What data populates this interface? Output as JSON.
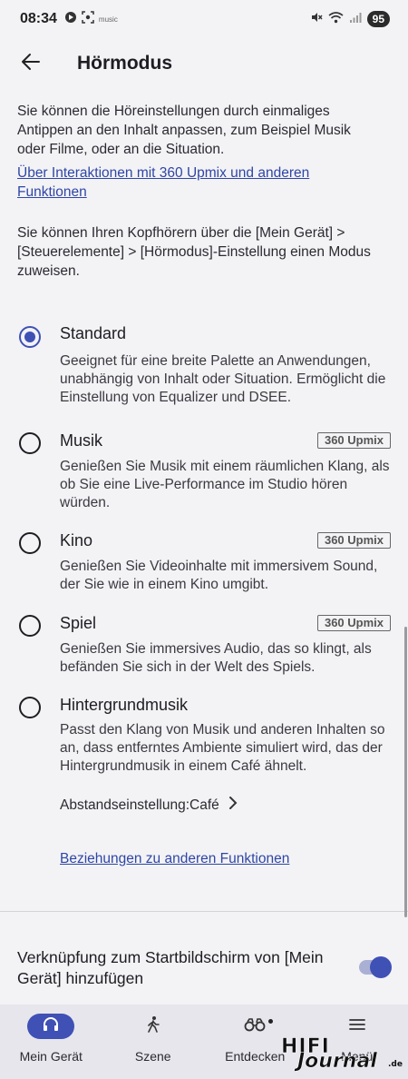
{
  "status_bar": {
    "time": "08:34",
    "battery": "95",
    "left_icons": [
      "podcast-icon",
      "screenshot-icon",
      "music-icon"
    ],
    "music_label": "music",
    "right_icons": [
      "mute-icon",
      "wifi-icon",
      "signal-icon"
    ]
  },
  "header": {
    "title": "Hörmodus",
    "back_icon": "arrow-left-icon"
  },
  "intro": {
    "text": "Sie können die Höreinstellungen durch einmaliges Antippen an den Inhalt anpassen, zum Beispiel Musik oder Filme, oder an die Situation.",
    "link": "Über Interaktionen mit 360 Upmix und anderen Funktionen",
    "assign_text": "Sie können Ihren Kopfhörern über die [Mein Gerät] > [Steuerelemente] > [Hörmodus]-Einstellung einen Modus zuweisen."
  },
  "options": [
    {
      "title": "Standard",
      "selected": true,
      "badge": "",
      "desc": "Geeignet für eine breite Palette an Anwendungen, unabhängig von Inhalt oder Situation. Ermöglicht die Einstellung von Equalizer und DSEE."
    },
    {
      "title": "Musik",
      "selected": false,
      "badge": "360 Upmix",
      "desc": "Genießen Sie Musik mit einem räumlichen Klang, als ob Sie eine Live-Performance im Studio hören würden."
    },
    {
      "title": "Kino",
      "selected": false,
      "badge": "360 Upmix",
      "desc": "Genießen Sie Videoinhalte mit immersivem Sound, der Sie wie in einem Kino umgibt."
    },
    {
      "title": "Spiel",
      "selected": false,
      "badge": "360 Upmix",
      "desc": "Genießen Sie immersives Audio, das so klingt, als befänden Sie sich in der Welt des Spiels."
    },
    {
      "title": "Hintergrundmusik",
      "selected": false,
      "badge": "",
      "desc": "Passt den Klang von Musik und anderen Inhalten so an, dass entferntes Ambiente simuliert wird, das der Hintergrundmusik in einem Café ähnelt."
    }
  ],
  "distance_setting": {
    "label": "Abstandseinstellung:Café",
    "icon": "chevron-right-icon"
  },
  "relations_link": "Beziehungen zu anderen Funktionen",
  "shortcut": {
    "text": "Verknüpfung zum Startbildschirm von [Mein Gerät] hinzufügen",
    "enabled": true
  },
  "bottom_nav": [
    {
      "label": "Mein Gerät",
      "icon": "headphones-icon",
      "active": true
    },
    {
      "label": "Szene",
      "icon": "walking-icon",
      "active": false
    },
    {
      "label": "Entdecken",
      "icon": "binoculars-icon",
      "active": false
    },
    {
      "label": "Menü",
      "icon": "hamburger-menu-icon",
      "active": false
    }
  ],
  "watermark": {
    "top": "HIFI",
    "bottom": "Journal",
    "suffix": ".de"
  },
  "colors": {
    "accent": "#3f51b5",
    "link": "#2f46a4",
    "background": "#f3f3f6",
    "nav_background": "#e6e6ec"
  }
}
